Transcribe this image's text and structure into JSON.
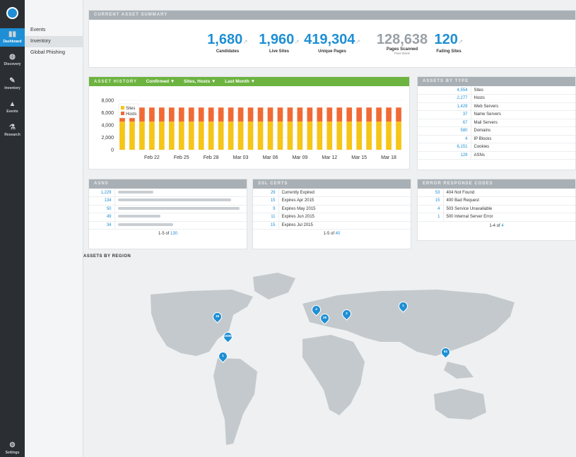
{
  "nav": {
    "rail": [
      {
        "label": "Dashboard",
        "icon": "bar-chart-icon",
        "active": true
      },
      {
        "label": "Discovery",
        "icon": "globe-icon"
      },
      {
        "label": "Inventory",
        "icon": "edit-icon"
      },
      {
        "label": "Events",
        "icon": "warning-icon"
      },
      {
        "label": "Research",
        "icon": "flask-icon"
      }
    ],
    "settings": "Settings",
    "sub": [
      "Events",
      "Inventory",
      "Global Phishing"
    ]
  },
  "summary": {
    "title": "CURRENT ASSET SUMMARY",
    "stats": [
      {
        "value": "1,680",
        "label": "Candidates"
      },
      {
        "value": "1,960",
        "label": "Live Sites"
      },
      {
        "value": "419,304",
        "label": "Unique Pages"
      },
      {
        "value": "128,638",
        "label": "Pages Scanned",
        "sub": "Past Week"
      },
      {
        "value": "120",
        "label": "Failing Sites"
      }
    ]
  },
  "history": {
    "title": "ASSET HISTORY",
    "filters": [
      "Confirmed ▼",
      "Sites, Hosts ▼",
      "Last Month ▼"
    ]
  },
  "chart_data": {
    "type": "bar",
    "stacked": true,
    "categories": [
      "Feb 19",
      "Feb 20",
      "Feb 21",
      "Feb 22",
      "Feb 23",
      "Feb 24",
      "Feb 25",
      "Feb 26",
      "Feb 27",
      "Feb 28",
      "Mar 01",
      "Mar 02",
      "Mar 03",
      "Mar 04",
      "Mar 05",
      "Mar 06",
      "Mar 07",
      "Mar 08",
      "Mar 09",
      "Mar 10",
      "Mar 11",
      "Mar 12",
      "Mar 13",
      "Mar 14",
      "Mar 15",
      "Mar 16",
      "Mar 17",
      "Mar 18",
      "Mar 19"
    ],
    "tick_labels": [
      "Feb 22",
      "Feb 25",
      "Feb 28",
      "Mar 03",
      "Mar 06",
      "Mar 09",
      "Mar 12",
      "Mar 15",
      "Mar 18"
    ],
    "series": [
      {
        "name": "Sites",
        "color": "#f5c518",
        "values": [
          4554,
          4554,
          4554,
          4554,
          4554,
          4554,
          4554,
          4554,
          4554,
          4554,
          4554,
          4554,
          4554,
          4554,
          4554,
          4554,
          4554,
          4554,
          4554,
          4554,
          4554,
          4554,
          4554,
          4554,
          4554,
          4554,
          4554,
          4554,
          4554
        ]
      },
      {
        "name": "Hosts",
        "color": "#f06a35",
        "values": [
          2277,
          2277,
          2277,
          2277,
          2277,
          2277,
          2277,
          2277,
          2277,
          2277,
          2277,
          2277,
          2277,
          2277,
          2277,
          2277,
          2277,
          2277,
          2277,
          2277,
          2277,
          2277,
          2277,
          2277,
          2277,
          2277,
          2277,
          2277,
          2277
        ]
      }
    ],
    "ylim": [
      0,
      8000
    ],
    "yticks": [
      "8,000",
      "6,000",
      "4,000",
      "2,000",
      "0"
    ],
    "legend": "top-left"
  },
  "types": {
    "title": "ASSETS BY TYPE",
    "rows": [
      {
        "n": "4,554",
        "label": "Sites"
      },
      {
        "n": "2,277",
        "label": "Hosts"
      },
      {
        "n": "1,429",
        "label": "Web Servers"
      },
      {
        "n": "37",
        "label": "Name Servers"
      },
      {
        "n": "67",
        "label": "Mail Servers"
      },
      {
        "n": "580",
        "label": "Domains"
      },
      {
        "n": "4",
        "label": "IP Blocks"
      },
      {
        "n": "6,151",
        "label": "Cookies"
      },
      {
        "n": "129",
        "label": "ASNs"
      }
    ]
  },
  "asns": {
    "title": "ASNS",
    "rows": [
      "1,229",
      "134",
      "50",
      "49",
      "34"
    ],
    "foot_pre": "1-5 of ",
    "foot_total": "130"
  },
  "ssl": {
    "title": "SSL CERTS",
    "rows": [
      {
        "n": "29",
        "label": "Currently Expired"
      },
      {
        "n": "15",
        "label": "Expires Apr 2015"
      },
      {
        "n": "9",
        "label": "Expires May 2015"
      },
      {
        "n": "11",
        "label": "Expires Jun 2015"
      },
      {
        "n": "15",
        "label": "Expires Jul 2015"
      }
    ],
    "foot_pre": "1-5 of ",
    "foot_total": "40"
  },
  "errors": {
    "title": "ERROR RESPONSE CODES",
    "rows": [
      {
        "n": "53",
        "label": "404 Not Found"
      },
      {
        "n": "15",
        "label": "400 Bad Request"
      },
      {
        "n": "4",
        "label": "503 Service Unavailable"
      },
      {
        "n": "1",
        "label": "500 Internal Server Error"
      }
    ],
    "foot_pre": "1-4 of ",
    "foot_total": "4"
  },
  "region": {
    "title": "ASSETS BY REGION",
    "pins": [
      "16",
      "2006",
      "1",
      "4",
      "25",
      "2",
      "1",
      "51"
    ]
  }
}
